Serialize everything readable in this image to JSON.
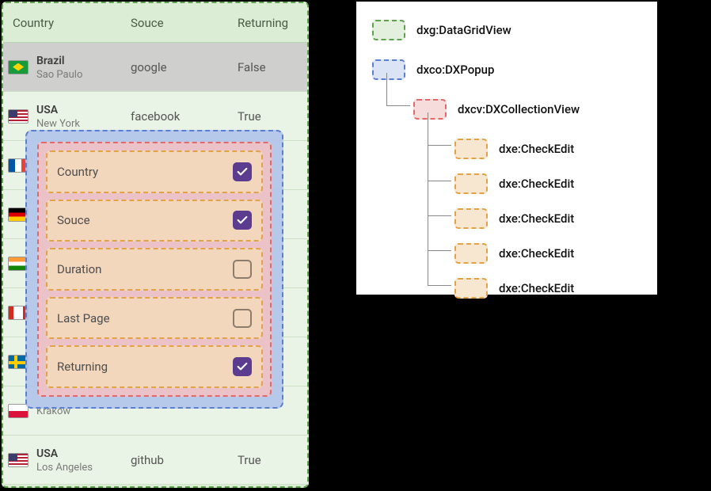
{
  "grid": {
    "headers": {
      "country": "Country",
      "source": "Souce",
      "returning": "Returning"
    },
    "rows": [
      {
        "country": "Brazil",
        "city": "Sao Paulo",
        "source": "google",
        "returning": "False",
        "flag": "br",
        "selected": true
      },
      {
        "country": "USA",
        "city": "New York",
        "source": "facebook",
        "returning": "True",
        "flag": "us"
      },
      {
        "country": "",
        "city": "",
        "source": "",
        "returning": "",
        "flag": "fr"
      },
      {
        "country": "",
        "city": "",
        "source": "",
        "returning": "",
        "flag": "de"
      },
      {
        "country": "",
        "city": "",
        "source": "",
        "returning": "",
        "flag": "in"
      },
      {
        "country": "",
        "city": "",
        "source": "",
        "returning": "",
        "flag": "ca"
      },
      {
        "country": "",
        "city": "",
        "source": "",
        "returning": "",
        "flag": "se"
      },
      {
        "country": "",
        "city": "Krakow",
        "source": "",
        "returning": "",
        "flag": "pl"
      },
      {
        "country": "USA",
        "city": "Los Angeles",
        "source": "github",
        "returning": "True",
        "flag": "us"
      }
    ]
  },
  "popup": {
    "items": [
      {
        "label": "Country",
        "checked": true
      },
      {
        "label": "Souce",
        "checked": true
      },
      {
        "label": "Duration",
        "checked": false
      },
      {
        "label": "Last Page",
        "checked": false
      },
      {
        "label": "Returning",
        "checked": true
      }
    ]
  },
  "legend": {
    "grid_view": "dxg:DataGridView",
    "popup": "dxco:DXPopup",
    "collection": "dxcv:DXCollectionView",
    "check_edit": "dxe:CheckEdit"
  }
}
